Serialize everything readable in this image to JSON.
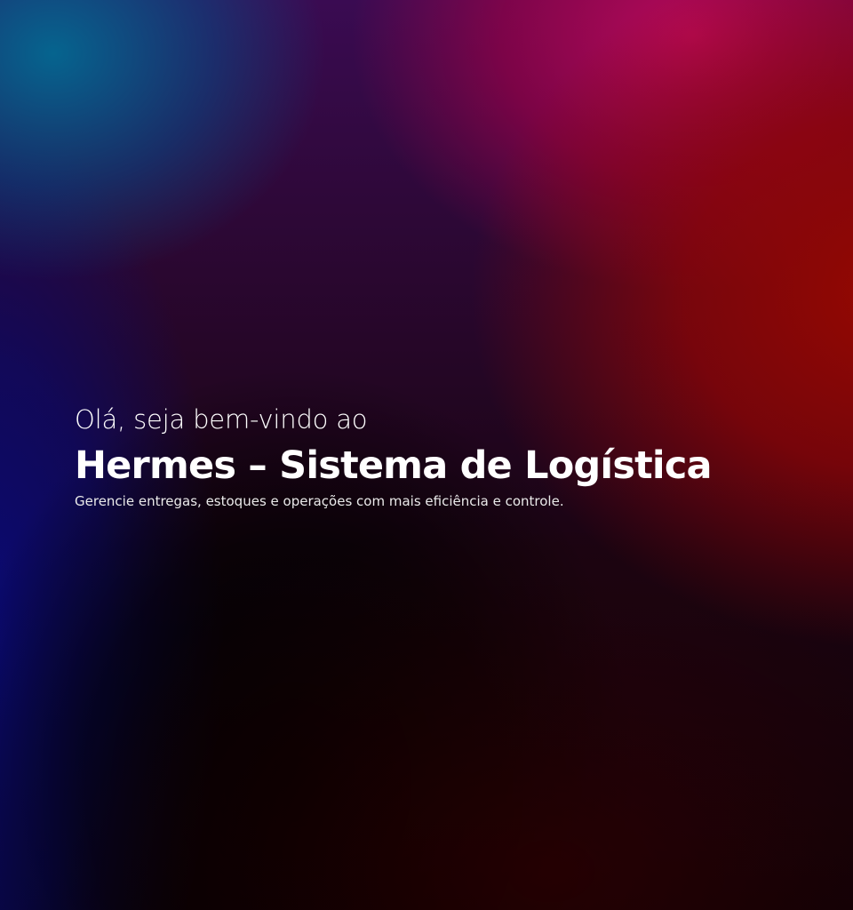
{
  "hero": {
    "greeting": "Olá, seja bem-vindo ao",
    "title": "Hermes – Sistema de Logística",
    "subtitle": "Gerencie entregas, estoques e operações com mais eficiência e controle."
  },
  "colors": {
    "text": "#ffffff",
    "gradient_blue": "#0a0a78",
    "gradient_teal": "#006e96",
    "gradient_magenta": "#be0a5a",
    "gradient_red": "#960800",
    "gradient_dark": "#000000"
  }
}
